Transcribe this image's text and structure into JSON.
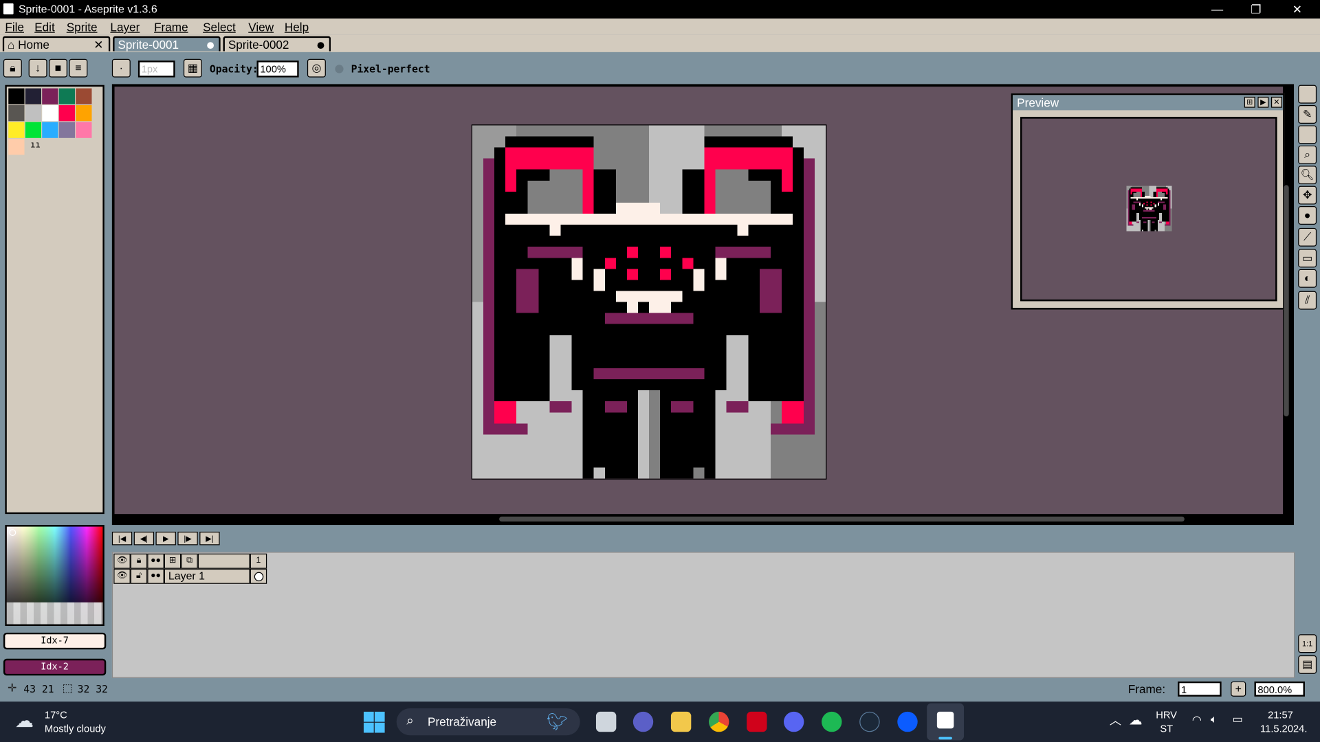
{
  "window": {
    "title": "Sprite-0001 - Aseprite v1.3.6"
  },
  "menu": [
    "File",
    "Edit",
    "Sprite",
    "Layer",
    "Frame",
    "Select",
    "View",
    "Help"
  ],
  "tabs": [
    {
      "label": "Home",
      "close": "✕"
    },
    {
      "label": "Sprite-0001"
    },
    {
      "label": "Sprite-0002"
    }
  ],
  "toolbar": {
    "brush_size": "1px",
    "opacity_label": "Opacity:",
    "opacity_value": "100%",
    "pixel_perfect_label": "Pixel-perfect"
  },
  "palette": {
    "colors": [
      "#000000",
      "#222034",
      "#7b2159",
      "#0e7a54",
      "#9b4a33",
      "#595652",
      "#c0c0c0",
      "#ffffff",
      "#ff004d",
      "#ffa300",
      "#ffec27",
      "#00e436",
      "#29adff",
      "#83769c",
      "#ff77a8",
      "#ffccaa"
    ],
    "more_label": "ıı"
  },
  "colors": {
    "accent": "#ff004d",
    "background": "#64525f",
    "panel": "#d3cbbe",
    "ui": "#7d929e",
    "fg_swatch": "#fdf0e8",
    "bg_swatch": "#7b2159"
  },
  "fg_color": {
    "label": "Idx-7"
  },
  "bg_color": {
    "label": "Idx-2"
  },
  "preview": {
    "title": "Preview"
  },
  "timeline": {
    "layer_name": "Layer 1",
    "frame_number": "1"
  },
  "status": {
    "cursor": "43 21",
    "size": "32 32",
    "frame_label": "Frame:",
    "frame_value": "1",
    "zoom": "800.0%"
  },
  "taskbar": {
    "temp": "17°C",
    "weather": "Mostly cloudy",
    "search": "Pretraživanje",
    "lang": "HRV",
    "lang2": "ST",
    "time": "21:57",
    "date": "11.5.2024."
  }
}
